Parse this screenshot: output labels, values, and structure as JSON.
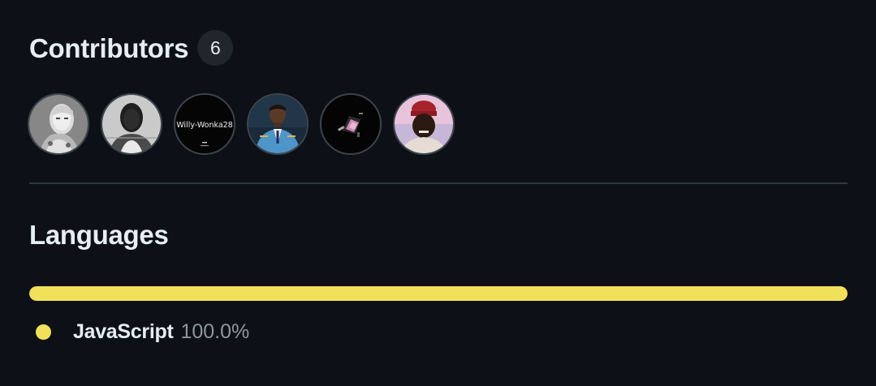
{
  "contributors": {
    "title": "Contributors",
    "count": "6",
    "avatars": [
      {
        "name": "contributor-1",
        "style": "robot-woman-grayscale"
      },
      {
        "name": "contributor-2",
        "style": "portrait-grayscale"
      },
      {
        "name": "contributor-3",
        "style": "text-logo",
        "text": "Willy-Wonka28"
      },
      {
        "name": "contributor-4",
        "style": "portrait-blue-uniform"
      },
      {
        "name": "contributor-5",
        "style": "dark-abstract"
      },
      {
        "name": "contributor-6",
        "style": "portrait-red-cap"
      }
    ]
  },
  "languages": {
    "title": "Languages",
    "items": [
      {
        "name": "JavaScript",
        "percent": "100.0%",
        "fraction": 1.0,
        "color": "#f1e05a"
      }
    ]
  },
  "colors": {
    "background": "#0d1117",
    "text": "#e6edf3",
    "muted": "#8d96a0",
    "divider": "#30363d",
    "counter_bg": "#21262d",
    "javascript": "#f1e05a"
  }
}
